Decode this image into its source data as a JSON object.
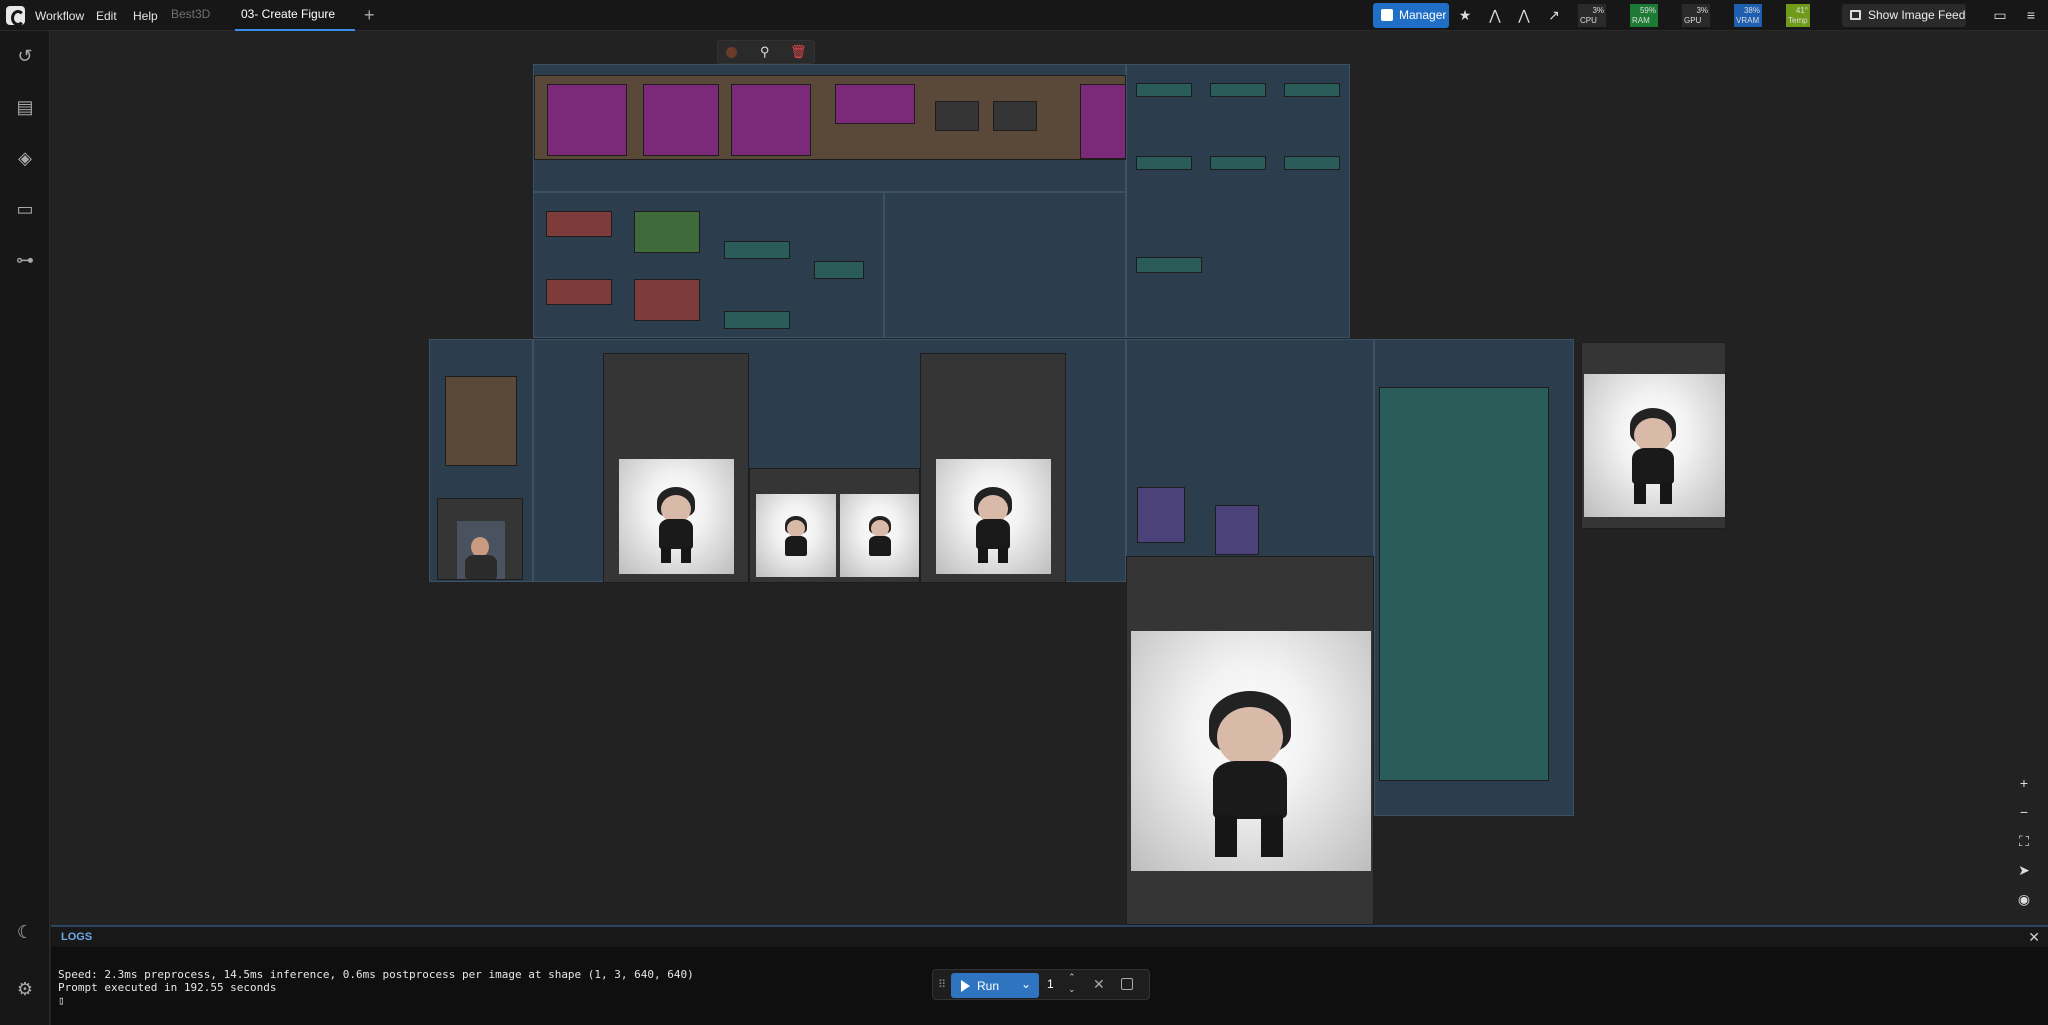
{
  "menu": {
    "workflow": "Workflow",
    "edit": "Edit",
    "help": "Help"
  },
  "tabs": [
    {
      "label": "Best3D",
      "active": false
    },
    {
      "label": "03- Create Figure",
      "active": true
    }
  ],
  "toolbar": {
    "manager_label": "Manager",
    "show_feed_label": "Show Image Feed"
  },
  "monitors": [
    {
      "name": "CPU",
      "value": "3%",
      "color": "#2a2a2a"
    },
    {
      "name": "RAM",
      "value": "59%",
      "color": "#1d7a35"
    },
    {
      "name": "GPU",
      "value": "3%",
      "color": "#2a2a2a"
    },
    {
      "name": "VRAM",
      "value": "38%",
      "color": "#1e5fb0"
    },
    {
      "name": "Temp",
      "value": "41°",
      "color": "#6f9a1a"
    }
  ],
  "logs": {
    "title": "LOGS",
    "lines": [
      "Speed: 2.3ms preprocess, 14.5ms inference, 0.6ms postprocess per image at shape (1, 3, 640, 640)",
      "Prompt executed in 192.55 seconds"
    ]
  },
  "run": {
    "label": "Run",
    "count": "1"
  },
  "colors": {
    "accent": "#2f74c0",
    "group": "#2c3d4d"
  }
}
